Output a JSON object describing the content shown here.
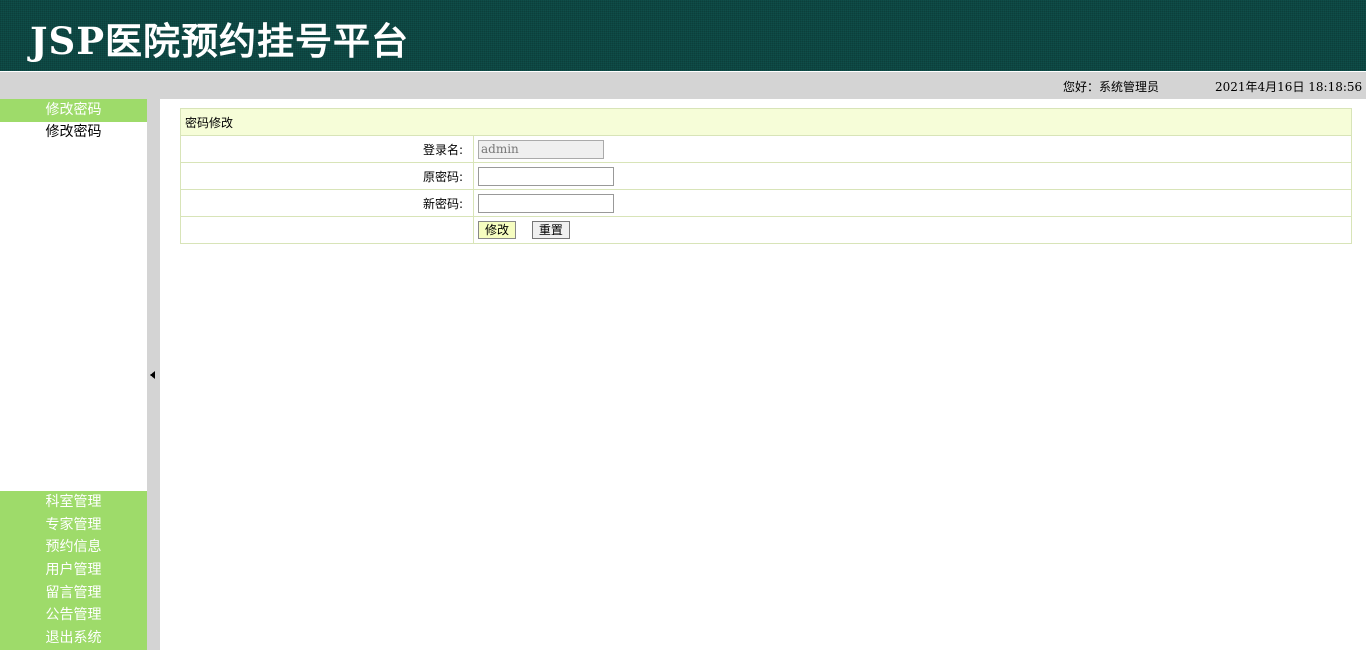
{
  "header": {
    "title": "JSP医院预约挂号平台"
  },
  "statusbar": {
    "greeting": "您好：系统管理员",
    "datetime": "2021年4月16日 18:18:56"
  },
  "sidebar": {
    "active_menu": {
      "title": "修改密码",
      "sub_item": "修改密码"
    },
    "menu_items": [
      "科室管理",
      "专家管理",
      "预约信息",
      "用户管理",
      "留言管理",
      "公告管理",
      "退出系统"
    ]
  },
  "form": {
    "title": "密码修改",
    "username_label": "登录名:",
    "username_value": "admin",
    "old_password_label": "原密码:",
    "old_password_value": "",
    "new_password_label": "新密码:",
    "new_password_value": "",
    "submit_label": "修改",
    "reset_label": "重置"
  },
  "colors": {
    "header_bg": "#0f4e49",
    "menu_green": "#9edb6a",
    "statusbar_bg": "#d4d4d4",
    "form_title_bg": "#f6fdd8",
    "table_border": "#d8e4b8"
  }
}
